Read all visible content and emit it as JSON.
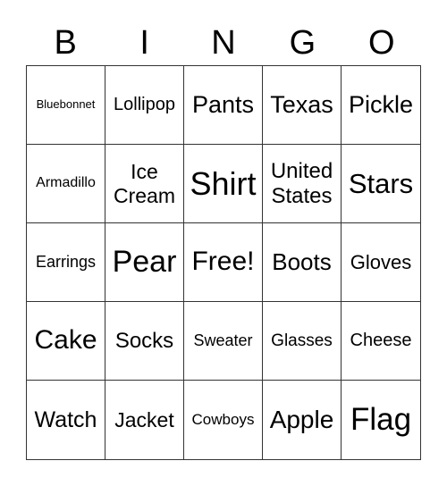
{
  "header": [
    "B",
    "I",
    "N",
    "G",
    "O"
  ],
  "cells": [
    "Bluebonnet",
    "Lollipop",
    "Pants",
    "Texas",
    "Pickle",
    "Armadillo",
    "Ice Cream",
    "Shirt",
    "United States",
    "Stars",
    "Earrings",
    "Pear",
    "Free!",
    "Boots",
    "Gloves",
    "Cake",
    "Socks",
    "Sweater",
    "Glasses",
    "Cheese",
    "Watch",
    "Jacket",
    "Cowboys",
    "Apple",
    "Flag"
  ]
}
